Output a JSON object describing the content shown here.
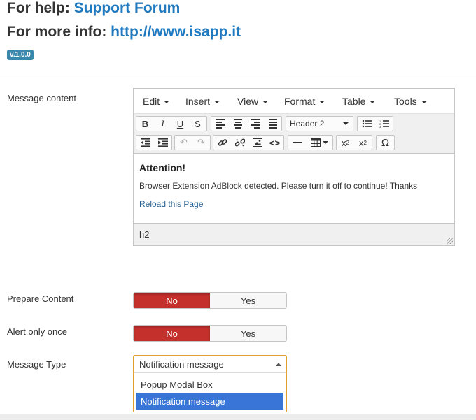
{
  "header": {
    "help_prefix": "For help:",
    "help_link": "Support Forum",
    "info_prefix": "For more info:",
    "info_link": "http://www.isapp.it",
    "version": "v.1.0.0"
  },
  "labels": {
    "message_content": "Message content",
    "prepare_content": "Prepare Content",
    "alert_once": "Alert only once",
    "message_type": "Message Type"
  },
  "editor": {
    "menu": [
      "Edit",
      "Insert",
      "View",
      "Format",
      "Table",
      "Tools"
    ],
    "block_format": "Header 2",
    "content": {
      "title": "Attention!",
      "text": "Browser Extension AdBlock detected. Please turn it off to continue!  Thanks",
      "link": "Reload this Page"
    },
    "status_path": "h2",
    "icons": [
      "bold-icon",
      "italic-icon",
      "underline-icon",
      "strikethrough-icon",
      "align-left-icon",
      "align-center-icon",
      "align-right-icon",
      "align-justify-icon",
      "bullet-list-icon",
      "numbered-list-icon",
      "outdent-icon",
      "indent-icon",
      "undo-icon",
      "redo-icon",
      "link-icon",
      "unlink-icon",
      "image-icon",
      "code-icon",
      "horizontal-rule-icon",
      "table-icon",
      "subscript-icon",
      "superscript-icon",
      "omega-icon"
    ]
  },
  "toggles": {
    "prepare_content": {
      "no": "No",
      "yes": "Yes",
      "selected": "No"
    },
    "alert_once": {
      "no": "No",
      "yes": "Yes",
      "selected": "No"
    }
  },
  "message_type": {
    "selected": "Notification message",
    "options": [
      "Popup Modal Box",
      "Notification message"
    ]
  },
  "colors": {
    "link": "#1f7ac0",
    "toggle_active": "#c4302b",
    "select_focus": "#e0a030",
    "option_highlight": "#3875d7",
    "badge": "#3a87ad"
  }
}
